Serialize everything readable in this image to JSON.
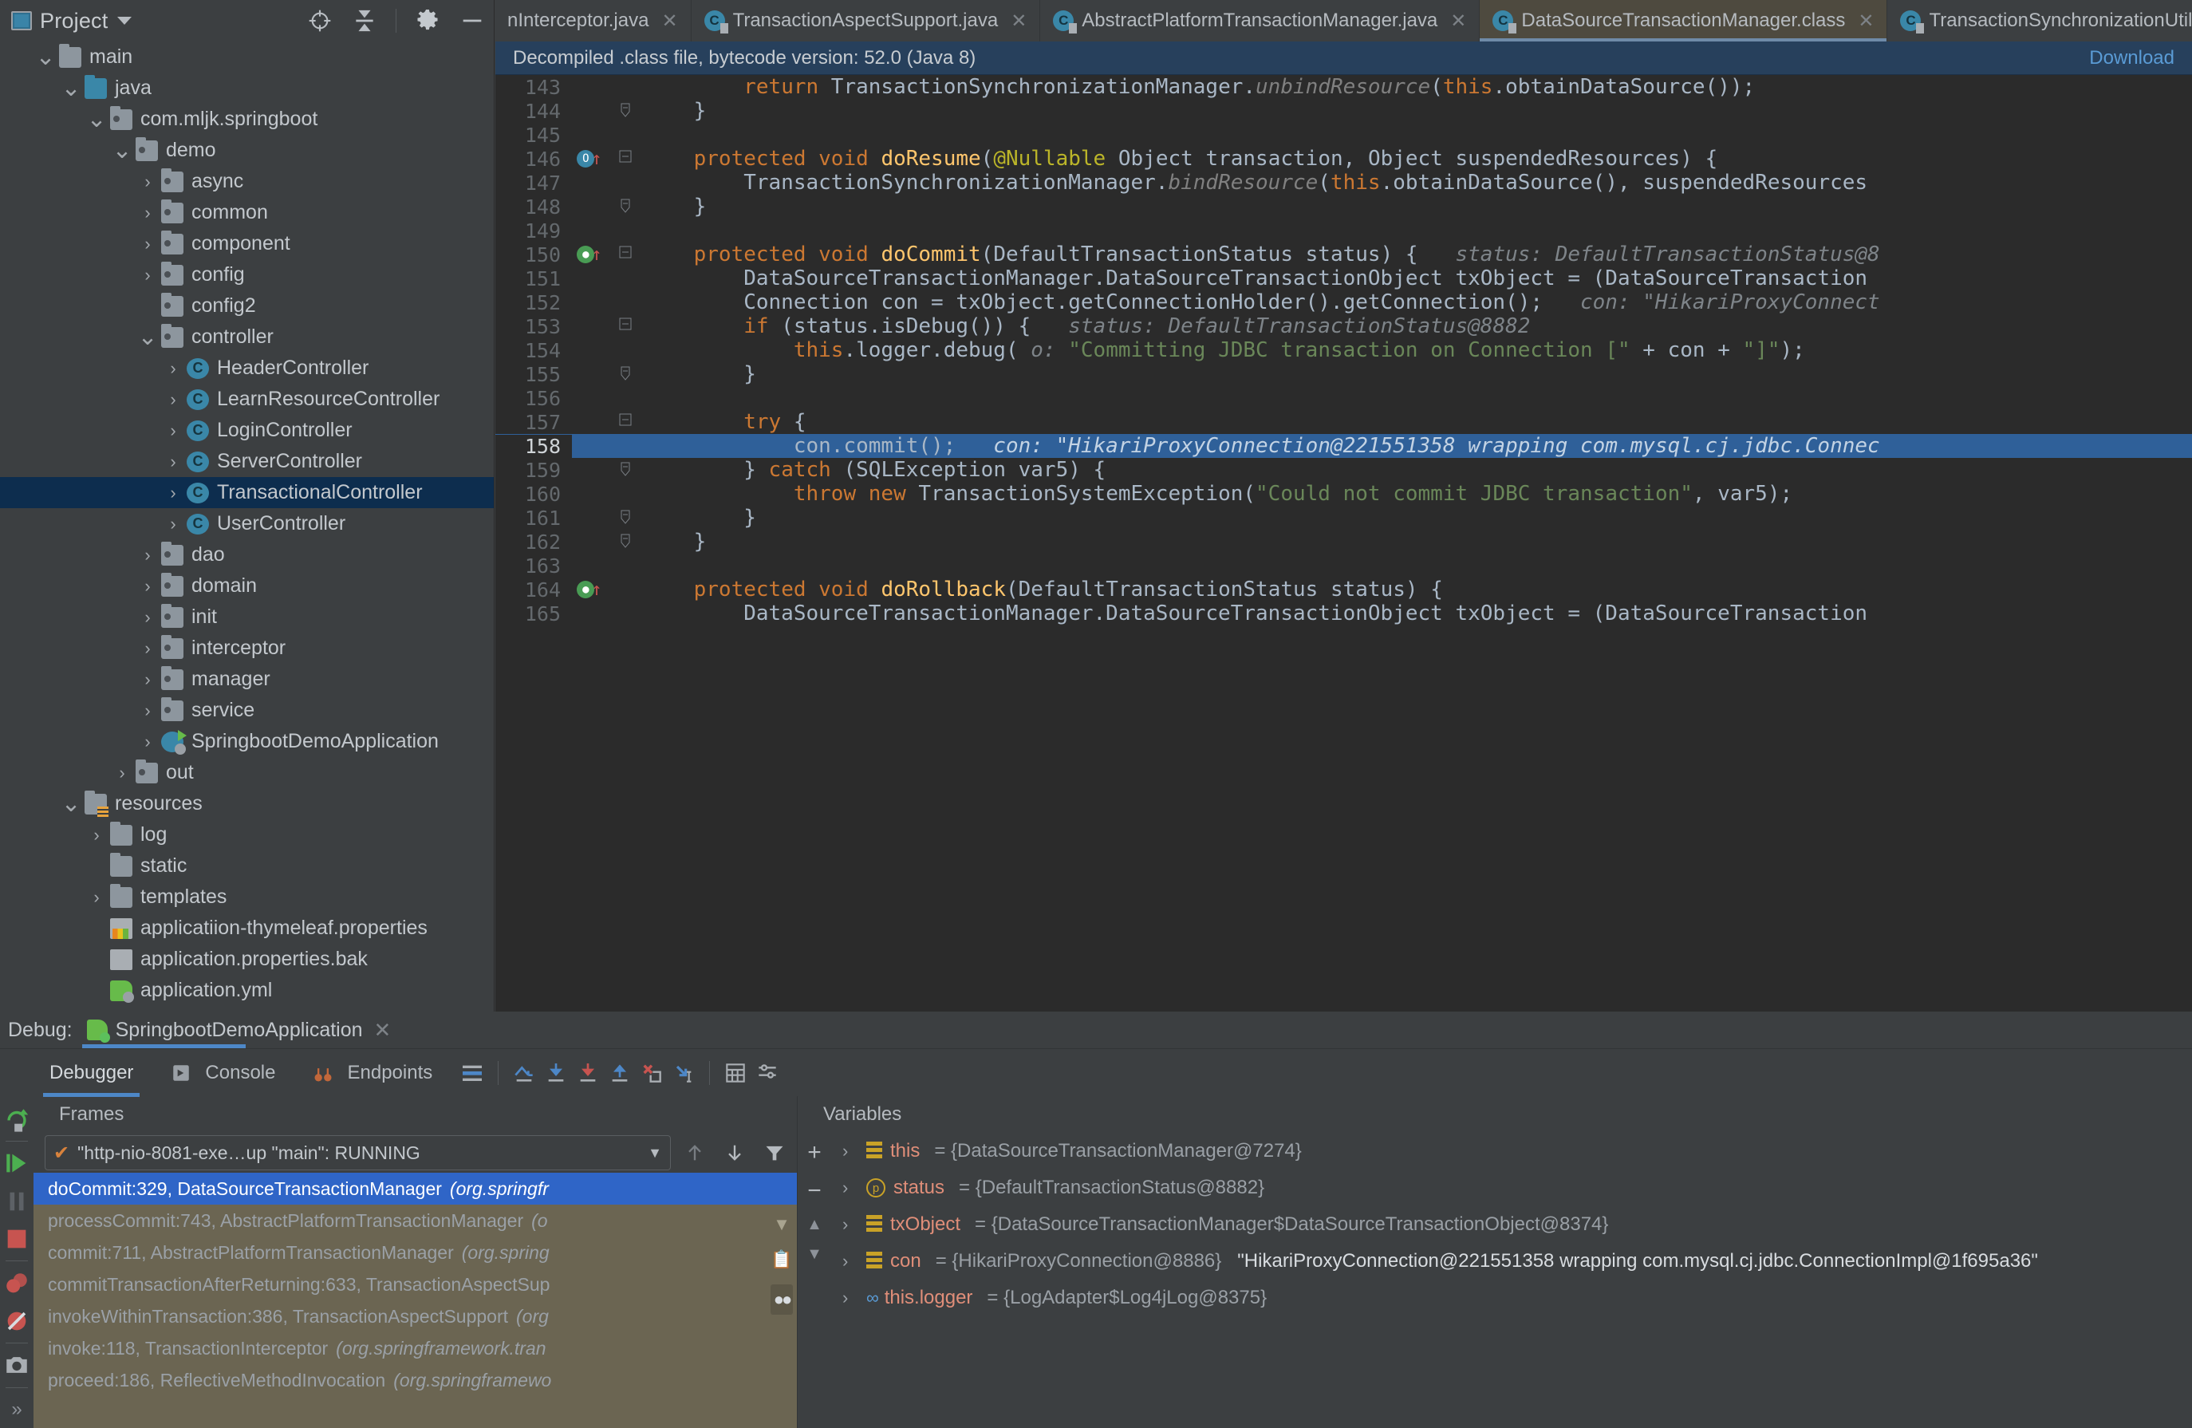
{
  "window": {
    "project_button": "Project",
    "toolbar_icons": [
      "locate-icon",
      "collapse-all-icon",
      "settings-gear-icon",
      "minimize-icon"
    ]
  },
  "tabs": [
    {
      "label": "nInterceptor.java",
      "icon": "java-class-icon",
      "active": false,
      "truncated": true
    },
    {
      "label": "TransactionAspectSupport.java",
      "icon": "java-class-icon",
      "active": false
    },
    {
      "label": "AbstractPlatformTransactionManager.java",
      "icon": "java-class-icon",
      "active": false
    },
    {
      "label": "DataSourceTransactionManager.class",
      "icon": "java-class-icon",
      "active": true
    },
    {
      "label": "TransactionSynchronizationUtils.j",
      "icon": "java-class-icon",
      "active": false
    }
  ],
  "sidebar": {
    "items": [
      {
        "label": "main",
        "indent": 1,
        "arrow": "down",
        "icon": "folder",
        "selected": false
      },
      {
        "label": "java",
        "indent": 2,
        "arrow": "down",
        "icon": "folder-blue",
        "selected": false
      },
      {
        "label": "com.mljk.springboot",
        "indent": 3,
        "arrow": "down",
        "icon": "package",
        "selected": false
      },
      {
        "label": "demo",
        "indent": 4,
        "arrow": "down",
        "icon": "package",
        "selected": false
      },
      {
        "label": "async",
        "indent": 5,
        "arrow": "right",
        "icon": "package",
        "selected": false
      },
      {
        "label": "common",
        "indent": 5,
        "arrow": "right",
        "icon": "package",
        "selected": false
      },
      {
        "label": "component",
        "indent": 5,
        "arrow": "right",
        "icon": "package",
        "selected": false
      },
      {
        "label": "config",
        "indent": 5,
        "arrow": "right",
        "icon": "package",
        "selected": false
      },
      {
        "label": "config2",
        "indent": 5,
        "arrow": "none",
        "icon": "package",
        "selected": false
      },
      {
        "label": "controller",
        "indent": 5,
        "arrow": "down",
        "icon": "package",
        "selected": false
      },
      {
        "label": "HeaderController",
        "indent": 6,
        "arrow": "right",
        "icon": "class",
        "selected": false
      },
      {
        "label": "LearnResourceController",
        "indent": 6,
        "arrow": "right",
        "icon": "class",
        "selected": false
      },
      {
        "label": "LoginController",
        "indent": 6,
        "arrow": "right",
        "icon": "class",
        "selected": false
      },
      {
        "label": "ServerController",
        "indent": 6,
        "arrow": "right",
        "icon": "class",
        "selected": false
      },
      {
        "label": "TransactionalController",
        "indent": 6,
        "arrow": "right",
        "icon": "class",
        "selected": true
      },
      {
        "label": "UserController",
        "indent": 6,
        "arrow": "right",
        "icon": "class",
        "selected": false
      },
      {
        "label": "dao",
        "indent": 5,
        "arrow": "right",
        "icon": "package",
        "selected": false
      },
      {
        "label": "domain",
        "indent": 5,
        "arrow": "right",
        "icon": "package",
        "selected": false
      },
      {
        "label": "init",
        "indent": 5,
        "arrow": "right",
        "icon": "package",
        "selected": false
      },
      {
        "label": "interceptor",
        "indent": 5,
        "arrow": "right",
        "icon": "package",
        "selected": false
      },
      {
        "label": "manager",
        "indent": 5,
        "arrow": "right",
        "icon": "package",
        "selected": false
      },
      {
        "label": "service",
        "indent": 5,
        "arrow": "right",
        "icon": "package",
        "selected": false
      },
      {
        "label": "SpringbootDemoApplication",
        "indent": 5,
        "arrow": "right",
        "icon": "spring",
        "selected": false
      },
      {
        "label": "out",
        "indent": 4,
        "arrow": "right",
        "icon": "package",
        "selected": false
      },
      {
        "label": "resources",
        "indent": 2,
        "arrow": "down",
        "icon": "resources-folder",
        "selected": false
      },
      {
        "label": "log",
        "indent": 3,
        "arrow": "right",
        "icon": "folder",
        "selected": false
      },
      {
        "label": "static",
        "indent": 3,
        "arrow": "none",
        "icon": "folder",
        "selected": false
      },
      {
        "label": "templates",
        "indent": 3,
        "arrow": "right",
        "icon": "folder",
        "selected": false
      },
      {
        "label": "applicatiion-thymeleaf.properties",
        "indent": 3,
        "arrow": "none",
        "icon": "properties-file",
        "selected": false
      },
      {
        "label": "application.properties.bak",
        "indent": 3,
        "arrow": "none",
        "icon": "file",
        "selected": false
      },
      {
        "label": "application.yml",
        "indent": 3,
        "arrow": "none",
        "icon": "yml-file",
        "selected": false
      }
    ]
  },
  "editor": {
    "notification": "Decompiled .class file, bytecode version: 52.0 (Java 8)",
    "download_link": "Download",
    "lines": [
      {
        "n": "143",
        "mark": "",
        "fold": "",
        "html": "        <span class=\"kw\">return</span> TransactionSynchronizationManager.<span class=\"cmt\">unbindResource</span>(<span class=\"kw\">this</span>.obtainDataSource());"
      },
      {
        "n": "144",
        "mark": "",
        "fold": "end",
        "html": "    }"
      },
      {
        "n": "145",
        "mark": "",
        "fold": "",
        "html": ""
      },
      {
        "n": "146",
        "mark": "override",
        "fold": "start",
        "html": "    <span class=\"kw\">protected void</span> <span class=\"mth\">doResume</span>(<span class=\"ann\">@Nullable</span> Object transaction, Object suspendedResources) {"
      },
      {
        "n": "147",
        "mark": "",
        "fold": "",
        "html": "        TransactionSynchronizationManager.<span class=\"cmt\">bindResource</span>(<span class=\"kw\">this</span>.obtainDataSource(), suspendedResources"
      },
      {
        "n": "148",
        "mark": "",
        "fold": "end",
        "html": "    }"
      },
      {
        "n": "149",
        "mark": "",
        "fold": "",
        "html": ""
      },
      {
        "n": "150",
        "mark": "breakpoint",
        "fold": "start",
        "html": "    <span class=\"kw\">protected void</span> <span class=\"mth\">doCommit</span>(DefaultTransactionStatus status) {   <span class=\"hint\">status: DefaultTransactionStatus@8</span>"
      },
      {
        "n": "151",
        "mark": "",
        "fold": "",
        "html": "        DataSourceTransactionManager.DataSourceTransactionObject txObject = (DataSourceTransaction"
      },
      {
        "n": "152",
        "mark": "",
        "fold": "",
        "html": "        Connection con = txObject.getConnectionHolder().getConnection();   <span class=\"hint\">con: \"HikariProxyConnect</span>"
      },
      {
        "n": "153",
        "mark": "",
        "fold": "start",
        "html": "        <span class=\"kw\">if</span> (status.isDebug()) {   <span class=\"hint\">status: DefaultTransactionStatus@8882</span>"
      },
      {
        "n": "154",
        "mark": "",
        "fold": "",
        "html": "            <span class=\"kw\">this</span>.logger.debug( <span class=\"hint\">o:</span> <span class=\"str\">\"Committing JDBC transaction on Connection [\"</span> + con + <span class=\"str\">\"]\"</span>);"
      },
      {
        "n": "155",
        "mark": "",
        "fold": "end",
        "html": "        }"
      },
      {
        "n": "156",
        "mark": "",
        "fold": "",
        "html": ""
      },
      {
        "n": "157",
        "mark": "",
        "fold": "start",
        "html": "        <span class=\"kw\">try</span> {"
      },
      {
        "n": "158",
        "mark": "",
        "fold": "",
        "highlight": true,
        "html": "            con.commit();   <span class=\"hint\">con: \"HikariProxyConnection@221551358 wrapping com.mysql.cj.jdbc.Connec</span>"
      },
      {
        "n": "159",
        "mark": "",
        "fold": "end",
        "html": "        } <span class=\"kw\">catch</span> (SQLException var5) {"
      },
      {
        "n": "160",
        "mark": "",
        "fold": "",
        "html": "            <span class=\"kw\">throw new</span> TransactionSystemException(<span class=\"str\">\"Could not commit JDBC transaction\"</span>, var5);"
      },
      {
        "n": "161",
        "mark": "",
        "fold": "end",
        "html": "        }"
      },
      {
        "n": "162",
        "mark": "",
        "fold": "end",
        "html": "    }"
      },
      {
        "n": "163",
        "mark": "",
        "fold": "",
        "html": ""
      },
      {
        "n": "164",
        "mark": "breakpoint",
        "fold": "",
        "html": "    <span class=\"kw\">protected void</span> <span class=\"mth\">doRollback</span>(DefaultTransactionStatus status) {"
      },
      {
        "n": "165",
        "mark": "",
        "fold": "",
        "html": "        DataSourceTransactionManager.DataSourceTransactionObject txObject = (DataSourceTransaction"
      }
    ]
  },
  "debug": {
    "title_prefix": "Debug:",
    "run_config": "SpringbootDemoApplication",
    "tabs": [
      {
        "label": "Debugger",
        "active": true,
        "icon": ""
      },
      {
        "label": "Console",
        "active": false,
        "icon": "console-icon"
      },
      {
        "label": "Endpoints",
        "active": false,
        "icon": "endpoints-icon"
      }
    ],
    "toolbar_icons": [
      "layout-icon",
      "force-step-over-icon",
      "step-over-icon",
      "step-into-icon",
      "step-out-icon",
      "force-step-into-icon",
      "run-to-cursor-icon",
      "evaluate-expression-icon",
      "settings-icon"
    ],
    "left_strip_icons": [
      "rerun-icon",
      "resume-program-icon",
      "pause-icon",
      "stop-icon",
      "view-breakpoints-icon",
      "mute-breakpoints-icon",
      "screenshot-icon",
      "expand-icon"
    ],
    "frames": {
      "header": "Frames",
      "thread": "\"http-nio-8081-exe…up \"main\": RUNNING",
      "thread_status_icon": "check-icon",
      "controls": [
        "up-arrow-icon",
        "down-arrow-icon",
        "filter-icon"
      ],
      "rows": [
        {
          "method": "doCommit:329, DataSourceTransactionManager",
          "pkg": "(org.springfr",
          "selected": true
        },
        {
          "method": "processCommit:743, AbstractPlatformTransactionManager",
          "pkg": "(o",
          "selected": false
        },
        {
          "method": "commit:711, AbstractPlatformTransactionManager",
          "pkg": "(org.spring",
          "selected": false
        },
        {
          "method": "commitTransactionAfterReturning:633, TransactionAspectSup",
          "pkg": "",
          "selected": false
        },
        {
          "method": "invokeWithinTransaction:386, TransactionAspectSupport",
          "pkg": "(org",
          "selected": false
        },
        {
          "method": "invoke:118, TransactionInterceptor",
          "pkg": "(org.springframework.tran",
          "selected": false
        },
        {
          "method": "proceed:186, ReflectiveMethodInvocation",
          "pkg": "(org.springframewo",
          "selected": false
        }
      ]
    },
    "variables": {
      "header": "Variables",
      "add_label": "+",
      "remove_label": "−",
      "rows": [
        {
          "icon": "fields-icon",
          "name": "this",
          "value": "= {DataSourceTransactionManager@7274}",
          "string": ""
        },
        {
          "icon": "parameter-icon",
          "name": "status",
          "value": "= {DefaultTransactionStatus@8882}",
          "string": ""
        },
        {
          "icon": "fields-icon",
          "name": "txObject",
          "value": "= {DataSourceTransactionManager$DataSourceTransactionObject@8374}",
          "string": ""
        },
        {
          "icon": "fields-icon",
          "name": "con",
          "value": "= {HikariProxyConnection@8886}",
          "string": "\"HikariProxyConnection@221551358 wrapping com.mysql.cj.jdbc.ConnectionImpl@1f695a36\""
        },
        {
          "icon": "watch-icon",
          "name": "this.logger",
          "value": "= {LogAdapter$Log4jLog@8375}",
          "string": ""
        }
      ]
    }
  },
  "colors": {
    "accent_blue": "#4d87c7",
    "selection_blue": "#2f6099",
    "frame_selected": "#2f65c7",
    "tree_selected": "#0d2d4e",
    "keyword_orange": "#cc7832",
    "method_yellow": "#ffc66d",
    "string_green": "#6a8759",
    "background": "#3c3f41",
    "editor_bg": "#2b2b2b"
  }
}
